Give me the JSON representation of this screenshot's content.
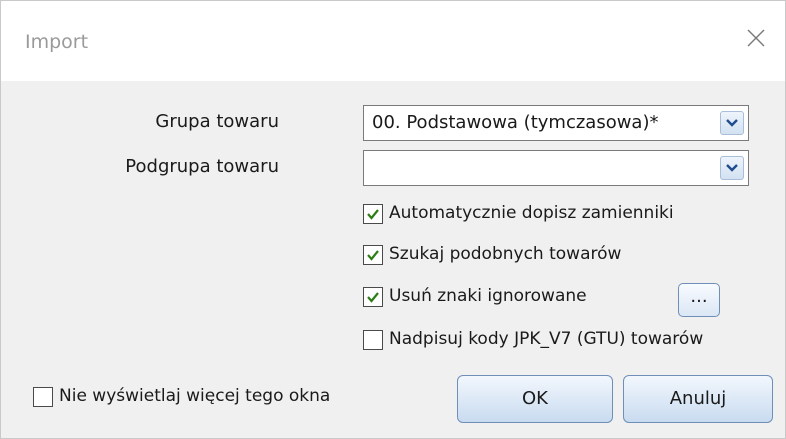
{
  "window": {
    "title": "Import"
  },
  "form": {
    "group_label": "Grupa towaru",
    "group_value": "00. Podstawowa (tymczasowa)*",
    "subgroup_label": "Podgrupa towaru",
    "subgroup_value": "",
    "options": [
      {
        "label": "Automatycznie dopisz zamienniki",
        "checked": true
      },
      {
        "label": "Szukaj podobnych towarów",
        "checked": true
      },
      {
        "label": "Usuń znaki ignorowane",
        "checked": true
      },
      {
        "label": "Nadpisuj kody JPK_V7 (GTU) towarów",
        "checked": false
      }
    ],
    "ellipsis_label": "...",
    "dont_show_label": "Nie wyświetlaj więcej tego okna",
    "dont_show_checked": false
  },
  "buttons": {
    "ok": "OK",
    "cancel": "Anuluj"
  },
  "colors": {
    "check": "#2d7d14",
    "title": "#9a9a9a"
  }
}
